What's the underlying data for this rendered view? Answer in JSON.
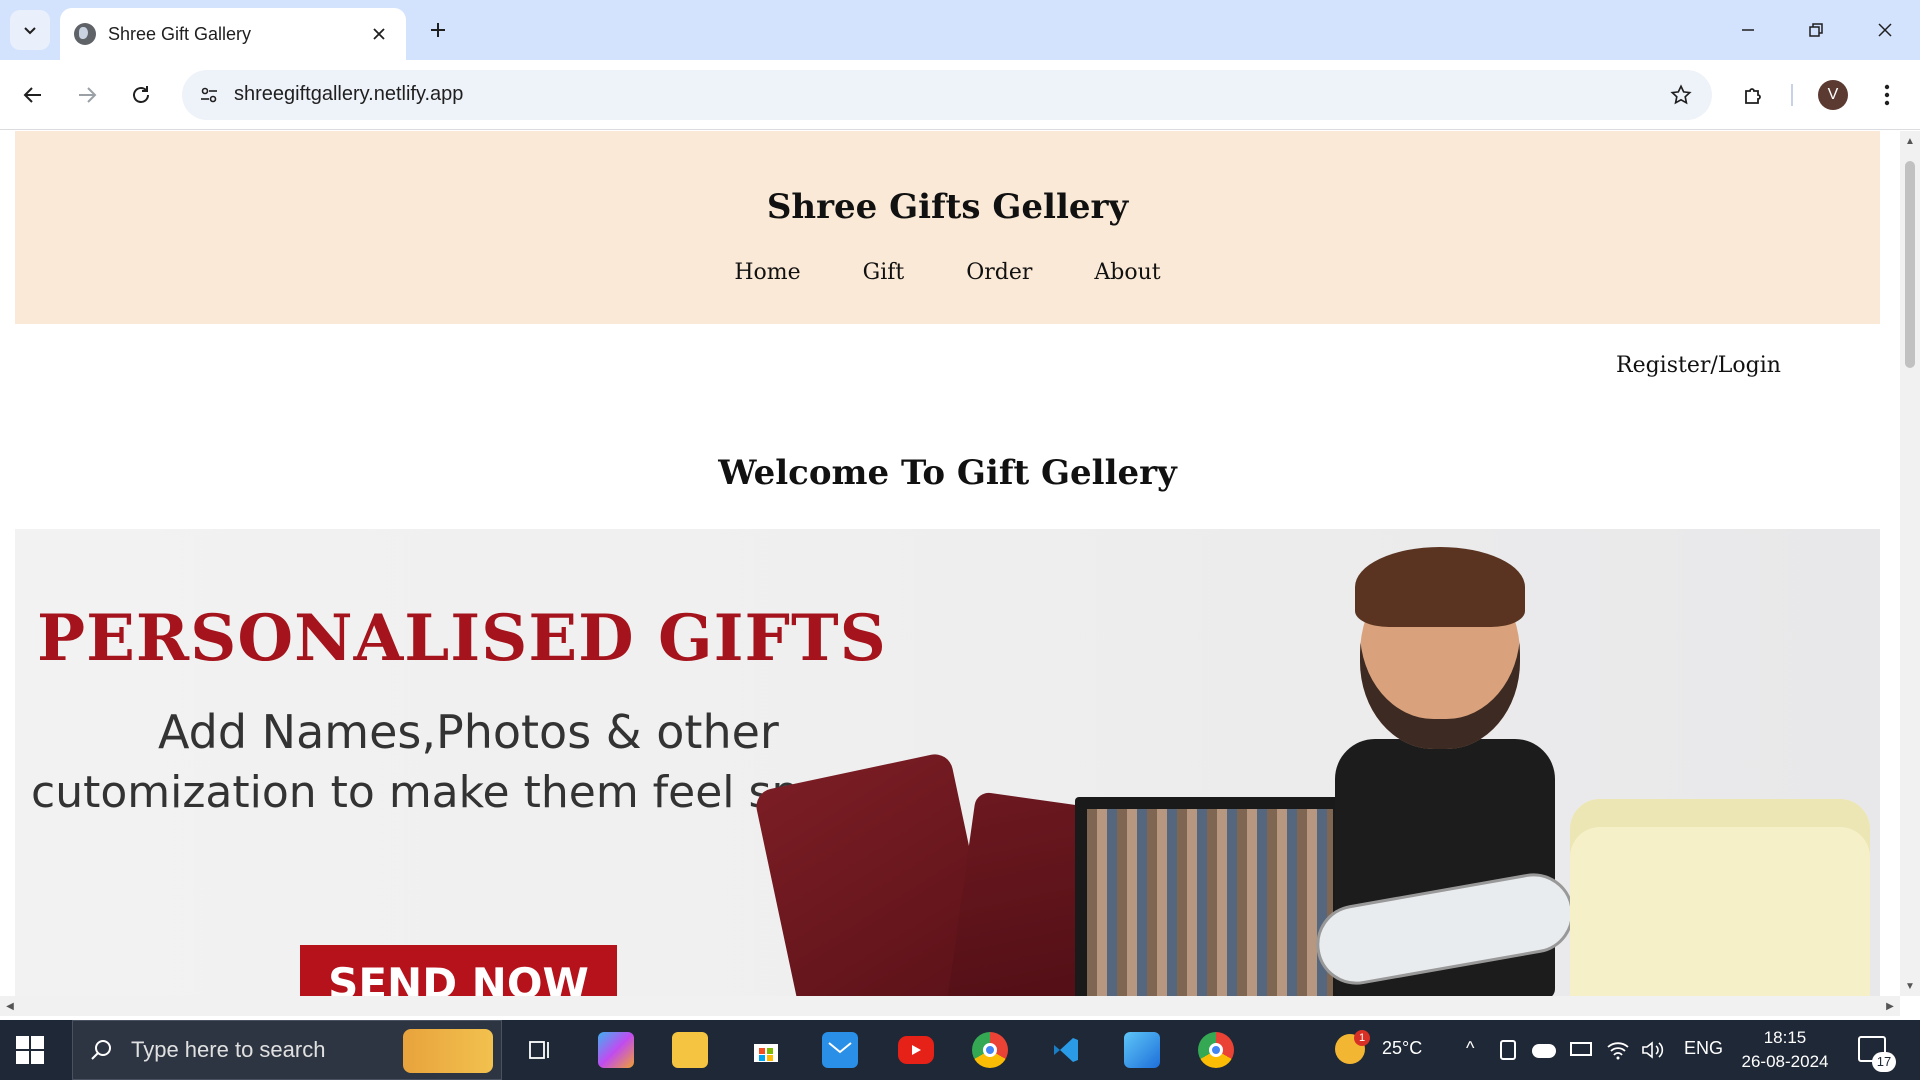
{
  "browser": {
    "tab_title": "Shree Gift Gallery",
    "url": "shreegiftgallery.netlify.app",
    "profile_initial": "V"
  },
  "site": {
    "title": "Shree Gifts Gellery",
    "nav": [
      "Home",
      "Gift",
      "Order",
      "About"
    ],
    "register_link": "Register/Login",
    "welcome": "Welcome To Gift Gellery",
    "banner": {
      "headline": "PERSONALISED GIFTS",
      "line1": "Add Names,Photos & other",
      "line2": "cutomization to make them feel special",
      "cta": "SEND NOW"
    }
  },
  "taskbar": {
    "search_placeholder": "Type here to search",
    "weather": "25°C",
    "weather_badge": "1",
    "language": "ENG",
    "time": "18:15",
    "date": "26-08-2024",
    "notifications": "17"
  },
  "colors": {
    "header_bg": "#fae9d6",
    "banner_red": "#b5121b",
    "taskbar_bg": "#1f2836"
  }
}
